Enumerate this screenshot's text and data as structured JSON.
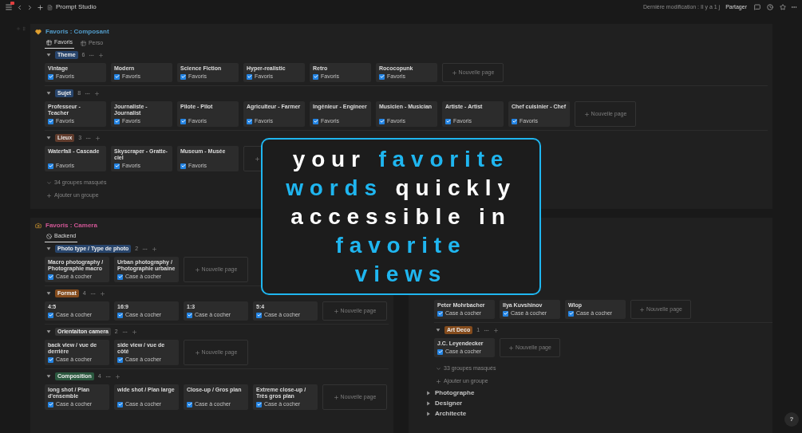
{
  "topbar": {
    "title": "Prompt Studio",
    "last_modified": "Dernière modification : Il y a 1 j",
    "share": "Partager"
  },
  "top_panel": {
    "title": "Favoris : Composant",
    "tabs": [
      {
        "label": "Favoris",
        "selected": true
      },
      {
        "label": "Perso",
        "selected": false
      }
    ],
    "groups": [
      {
        "name": "Theme",
        "color": "#28456c",
        "count": "6",
        "expanded": true,
        "add_card": true,
        "add_label": "Nouvelle page",
        "cards": [
          {
            "title": "Vintage",
            "check": "Favoris",
            "checked": true
          },
          {
            "title": "Modern",
            "check": "Favoris",
            "checked": true
          },
          {
            "title": "Science Fiction",
            "check": "Favoris",
            "checked": true
          },
          {
            "title": "Hyper-realistic",
            "check": "Favoris",
            "checked": true
          },
          {
            "title": "Retro",
            "check": "Favoris",
            "checked": true
          },
          {
            "title": "Rococopunk",
            "check": "Favoris",
            "checked": true
          }
        ]
      },
      {
        "name": "Sujet",
        "color": "#28456c",
        "count": "8",
        "expanded": true,
        "add_card": true,
        "add_label": "Nouvelle page",
        "cards": [
          {
            "title": "Professeur - Teacher",
            "check": "Favoris",
            "checked": true
          },
          {
            "title": "Journaliste - Journalist",
            "check": "Favoris",
            "checked": true
          },
          {
            "title": "Pilote - Pilot",
            "check": "Favoris",
            "checked": true
          },
          {
            "title": "Agriculteur - Farmer",
            "check": "Favoris",
            "checked": true
          },
          {
            "title": "Ingénieur - Engineer",
            "check": "Favoris",
            "checked": true
          },
          {
            "title": "Musicien - Musician",
            "check": "Favoris",
            "checked": true
          },
          {
            "title": "Artiste - Artist",
            "check": "Favoris",
            "checked": true
          },
          {
            "title": "Chef cuisinier - Chef",
            "check": "Favoris",
            "checked": true
          }
        ]
      },
      {
        "name": "Lieux",
        "color": "#603b2c",
        "count": "3",
        "expanded": true,
        "add_card": true,
        "cards": [
          {
            "title": "Waterfall - Cascade",
            "check": "Favoris",
            "checked": true
          },
          {
            "title": "Skyscraper - Gratte-ciel",
            "check": "Favoris",
            "checked": true
          },
          {
            "title": "Museum - Musée",
            "check": "Favoris",
            "checked": true
          }
        ]
      }
    ],
    "hidden_groups": "34 groupes masqués",
    "add_group": "Ajouter un groupe"
  },
  "camera_panel": {
    "title": "Favoris : Camera",
    "tabs": [
      {
        "label": "Backend",
        "selected": true
      }
    ],
    "groups": [
      {
        "name": "Photo type / Type de photo",
        "color": "#28456c",
        "count": "2",
        "expanded": true,
        "add_card": true,
        "add_label": "Nouvelle page",
        "cards": [
          {
            "title": "Macro photography / Photographie macro",
            "check": "Case à cocher",
            "checked": true
          },
          {
            "title": "Urban photography / Photographie urbaine",
            "check": "Case à cocher",
            "checked": true
          }
        ]
      },
      {
        "name": "Format",
        "color": "#854c1d",
        "count": "4",
        "expanded": true,
        "add_card": true,
        "add_label": "Nouvelle page",
        "cards": [
          {
            "title": "4:5",
            "check": "Case à cocher",
            "checked": true
          },
          {
            "title": "16:9",
            "check": "Case à cocher",
            "checked": true
          },
          {
            "title": "1:3",
            "check": "Case à cocher",
            "checked": true
          },
          {
            "title": "5:4",
            "check": "Case à cocher",
            "checked": true
          }
        ]
      },
      {
        "name": "Orientaiton camera",
        "color": "#373737",
        "count": "2",
        "expanded": true,
        "add_card": true,
        "add_label": "Nouvelle page",
        "cards": [
          {
            "title": "back view / vue de derrière",
            "check": "Case à cocher",
            "checked": true
          },
          {
            "title": "side view / vue de côté",
            "check": "Case à cocher",
            "checked": true
          }
        ]
      },
      {
        "name": "Composition",
        "color": "#2b593f",
        "count": "4",
        "expanded": true,
        "add_card": true,
        "add_label": "Nouvelle page",
        "cards": [
          {
            "title": "long shot / Plan d'ensemble",
            "check": "Case à cocher",
            "checked": true
          },
          {
            "title": "wide shot / Plan large",
            "check": "Case à cocher",
            "checked": true
          },
          {
            "title": "Close-up / Gros plan",
            "check": "Case à cocher",
            "checked": true
          },
          {
            "title": "Extreme close-up / Très gros plan",
            "check": "Case à cocher",
            "checked": true
          }
        ]
      }
    ]
  },
  "right_panel": {
    "groups": [
      {
        "add_card": true,
        "add_label": "Nouvelle page",
        "cards": [
          {
            "title": "Peter Mohrbacher",
            "check": "Case à cocher",
            "checked": true
          },
          {
            "title": "Ilya Kuvshinov",
            "check": "Case à cocher",
            "checked": true
          },
          {
            "title": "Wlop",
            "check": "Case à cocher",
            "checked": true
          }
        ]
      },
      {
        "name": "Art Deco",
        "color": "#854c1d",
        "count": "1",
        "expanded": true,
        "add_card": true,
        "add_label": "Nouvelle page",
        "cards": [
          {
            "title": "J.C. Leyendecker",
            "check": "Case à cocher",
            "checked": true
          }
        ]
      }
    ],
    "hidden_groups": "33 groupes masqués",
    "add_group": "Ajouter un groupe",
    "toggles": [
      {
        "label": "Photographe",
        "expanded": false
      },
      {
        "label": "Designer",
        "expanded": false
      },
      {
        "label": "Architecte",
        "expanded": false
      }
    ]
  },
  "overlay": {
    "lines": [
      [
        {
          "text": "your",
          "accent": false
        },
        {
          "text": "favorite",
          "accent": true
        }
      ],
      [
        {
          "text": "words",
          "accent": true
        },
        {
          "text": "quickly",
          "accent": false
        }
      ],
      [
        {
          "text": "accessible in",
          "accent": false
        }
      ],
      [
        {
          "text": "favorite",
          "accent": true
        }
      ],
      [
        {
          "text": "views",
          "accent": true
        }
      ]
    ]
  },
  "help": "?"
}
